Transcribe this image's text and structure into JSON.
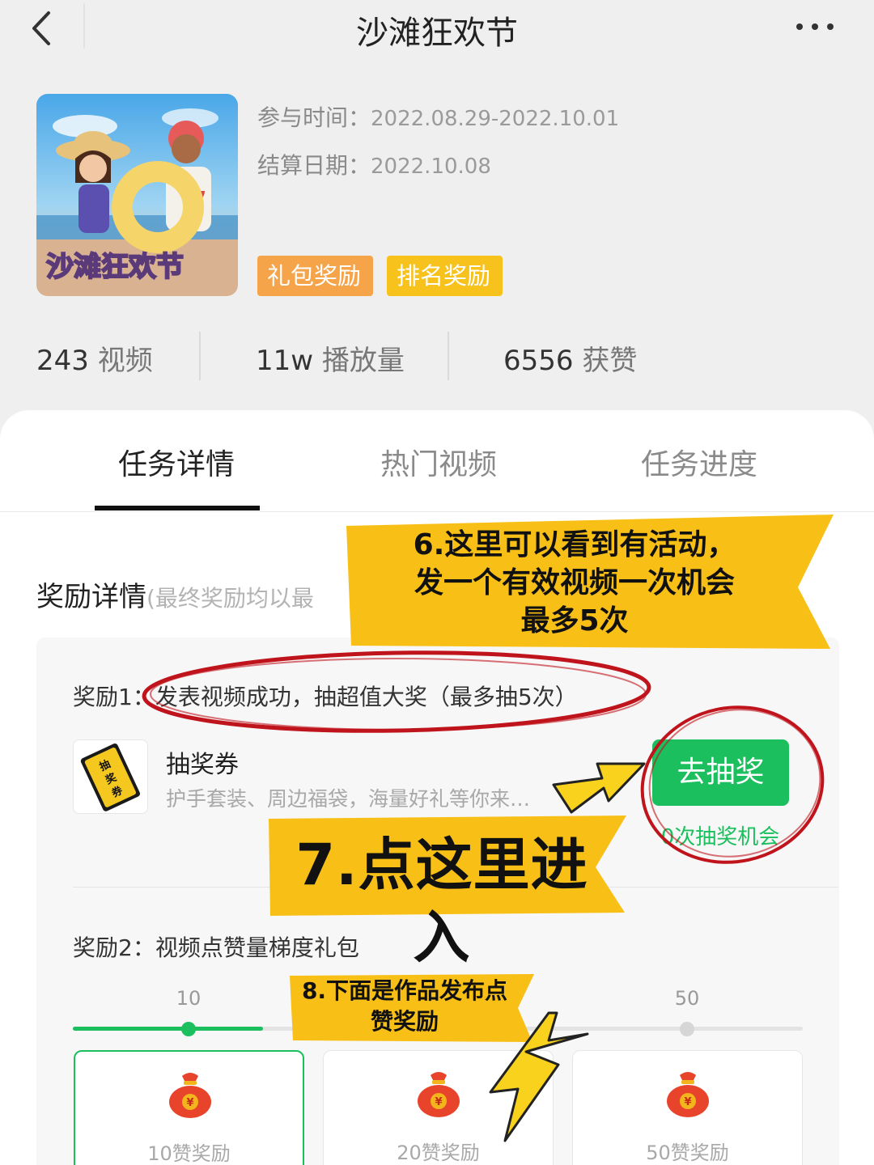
{
  "nav": {
    "title": "沙滩狂欢节"
  },
  "header": {
    "cover_text": "沙滩狂欢节",
    "participation_label": "参与时间：",
    "participation_value": "2022.08.29-2022.10.01",
    "settlement_label": "结算日期：",
    "settlement_value": "2022.10.08",
    "tags": [
      "礼包奖励",
      "排名奖励"
    ]
  },
  "stats": [
    {
      "value": "243",
      "label": "视频"
    },
    {
      "value": "11w",
      "label": "播放量"
    },
    {
      "value": "6556",
      "label": "获赞"
    }
  ],
  "tabs": [
    "任务详情",
    "热门视频",
    "任务进度"
  ],
  "rewards": {
    "title": "奖励详情",
    "subtitle": "(最终奖励均以最",
    "reward1": {
      "title": "奖励1：发表视频成功，抽超值大奖（最多抽5次）",
      "item_name": "抽奖券",
      "item_icon_text": "抽奖券",
      "item_desc": "护手套装、周边福袋，海量好礼等你来…",
      "button": "去抽奖",
      "chances": "0次抽奖机会"
    },
    "reward2": {
      "title": "奖励2：视频点赞量梯度礼包",
      "ticks": [
        "10",
        "50"
      ],
      "progress_fraction": 0.26,
      "prizes": [
        {
          "label": "10赞奖励",
          "active": true
        },
        {
          "label": "20赞奖励",
          "active": false
        },
        {
          "label": "50赞奖励",
          "active": false
        }
      ]
    }
  },
  "annotations": {
    "note6": "6.这里可以看到有活动，\n发一个有效视频一次机会\n最多5次",
    "note7": "7.点这里进入",
    "note8": "8.下面是作品发布点\n赞奖励"
  },
  "colors": {
    "accent_green": "#1cbf5e",
    "tag_orange": "#f5a44a",
    "tag_yellow": "#f7c21c",
    "annotation_yellow": "#f8c016",
    "annotation_red": "#c0141c"
  },
  "icons": [
    "back-arrow-icon",
    "more-dots-icon",
    "lottery-ticket-icon",
    "money-bag-icon"
  ]
}
